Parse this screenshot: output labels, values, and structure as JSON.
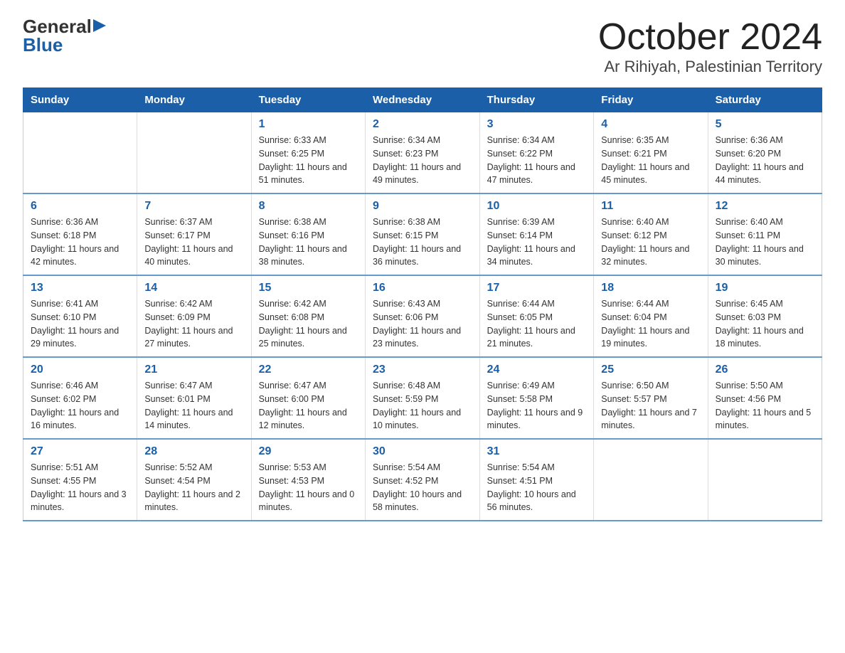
{
  "logo": {
    "general": "General",
    "blue": "Blue"
  },
  "title": "October 2024",
  "subtitle": "Ar Rihiyah, Palestinian Territory",
  "days_header": [
    "Sunday",
    "Monday",
    "Tuesday",
    "Wednesday",
    "Thursday",
    "Friday",
    "Saturday"
  ],
  "weeks": [
    [
      {
        "day": "",
        "info": ""
      },
      {
        "day": "",
        "info": ""
      },
      {
        "day": "1",
        "info": "Sunrise: 6:33 AM\nSunset: 6:25 PM\nDaylight: 11 hours and 51 minutes."
      },
      {
        "day": "2",
        "info": "Sunrise: 6:34 AM\nSunset: 6:23 PM\nDaylight: 11 hours and 49 minutes."
      },
      {
        "day": "3",
        "info": "Sunrise: 6:34 AM\nSunset: 6:22 PM\nDaylight: 11 hours and 47 minutes."
      },
      {
        "day": "4",
        "info": "Sunrise: 6:35 AM\nSunset: 6:21 PM\nDaylight: 11 hours and 45 minutes."
      },
      {
        "day": "5",
        "info": "Sunrise: 6:36 AM\nSunset: 6:20 PM\nDaylight: 11 hours and 44 minutes."
      }
    ],
    [
      {
        "day": "6",
        "info": "Sunrise: 6:36 AM\nSunset: 6:18 PM\nDaylight: 11 hours and 42 minutes."
      },
      {
        "day": "7",
        "info": "Sunrise: 6:37 AM\nSunset: 6:17 PM\nDaylight: 11 hours and 40 minutes."
      },
      {
        "day": "8",
        "info": "Sunrise: 6:38 AM\nSunset: 6:16 PM\nDaylight: 11 hours and 38 minutes."
      },
      {
        "day": "9",
        "info": "Sunrise: 6:38 AM\nSunset: 6:15 PM\nDaylight: 11 hours and 36 minutes."
      },
      {
        "day": "10",
        "info": "Sunrise: 6:39 AM\nSunset: 6:14 PM\nDaylight: 11 hours and 34 minutes."
      },
      {
        "day": "11",
        "info": "Sunrise: 6:40 AM\nSunset: 6:12 PM\nDaylight: 11 hours and 32 minutes."
      },
      {
        "day": "12",
        "info": "Sunrise: 6:40 AM\nSunset: 6:11 PM\nDaylight: 11 hours and 30 minutes."
      }
    ],
    [
      {
        "day": "13",
        "info": "Sunrise: 6:41 AM\nSunset: 6:10 PM\nDaylight: 11 hours and 29 minutes."
      },
      {
        "day": "14",
        "info": "Sunrise: 6:42 AM\nSunset: 6:09 PM\nDaylight: 11 hours and 27 minutes."
      },
      {
        "day": "15",
        "info": "Sunrise: 6:42 AM\nSunset: 6:08 PM\nDaylight: 11 hours and 25 minutes."
      },
      {
        "day": "16",
        "info": "Sunrise: 6:43 AM\nSunset: 6:06 PM\nDaylight: 11 hours and 23 minutes."
      },
      {
        "day": "17",
        "info": "Sunrise: 6:44 AM\nSunset: 6:05 PM\nDaylight: 11 hours and 21 minutes."
      },
      {
        "day": "18",
        "info": "Sunrise: 6:44 AM\nSunset: 6:04 PM\nDaylight: 11 hours and 19 minutes."
      },
      {
        "day": "19",
        "info": "Sunrise: 6:45 AM\nSunset: 6:03 PM\nDaylight: 11 hours and 18 minutes."
      }
    ],
    [
      {
        "day": "20",
        "info": "Sunrise: 6:46 AM\nSunset: 6:02 PM\nDaylight: 11 hours and 16 minutes."
      },
      {
        "day": "21",
        "info": "Sunrise: 6:47 AM\nSunset: 6:01 PM\nDaylight: 11 hours and 14 minutes."
      },
      {
        "day": "22",
        "info": "Sunrise: 6:47 AM\nSunset: 6:00 PM\nDaylight: 11 hours and 12 minutes."
      },
      {
        "day": "23",
        "info": "Sunrise: 6:48 AM\nSunset: 5:59 PM\nDaylight: 11 hours and 10 minutes."
      },
      {
        "day": "24",
        "info": "Sunrise: 6:49 AM\nSunset: 5:58 PM\nDaylight: 11 hours and 9 minutes."
      },
      {
        "day": "25",
        "info": "Sunrise: 6:50 AM\nSunset: 5:57 PM\nDaylight: 11 hours and 7 minutes."
      },
      {
        "day": "26",
        "info": "Sunrise: 5:50 AM\nSunset: 4:56 PM\nDaylight: 11 hours and 5 minutes."
      }
    ],
    [
      {
        "day": "27",
        "info": "Sunrise: 5:51 AM\nSunset: 4:55 PM\nDaylight: 11 hours and 3 minutes."
      },
      {
        "day": "28",
        "info": "Sunrise: 5:52 AM\nSunset: 4:54 PM\nDaylight: 11 hours and 2 minutes."
      },
      {
        "day": "29",
        "info": "Sunrise: 5:53 AM\nSunset: 4:53 PM\nDaylight: 11 hours and 0 minutes."
      },
      {
        "day": "30",
        "info": "Sunrise: 5:54 AM\nSunset: 4:52 PM\nDaylight: 10 hours and 58 minutes."
      },
      {
        "day": "31",
        "info": "Sunrise: 5:54 AM\nSunset: 4:51 PM\nDaylight: 10 hours and 56 minutes."
      },
      {
        "day": "",
        "info": ""
      },
      {
        "day": "",
        "info": ""
      }
    ]
  ]
}
